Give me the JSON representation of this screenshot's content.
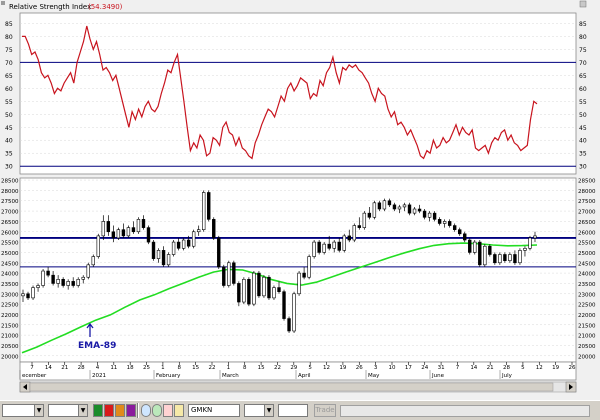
{
  "chart_data": [
    {
      "type": "line",
      "title": "Relative Strength Index",
      "value_label": "(54.3490)",
      "ylim": [
        27,
        89
      ],
      "y_ticks": [
        "30",
        "35",
        "40",
        "45",
        "50",
        "55",
        "60",
        "65",
        "70",
        "75",
        "80",
        "85"
      ],
      "reference_lines": [
        30,
        70
      ],
      "series": [
        {
          "name": "RSI",
          "x": [
            0,
            1,
            2,
            3,
            4,
            5,
            6,
            7,
            8,
            9,
            10,
            11,
            12,
            13,
            14,
            15,
            16,
            17,
            18,
            19,
            20,
            21,
            22,
            23,
            24,
            25,
            26,
            27,
            28,
            29,
            30,
            31,
            32,
            33,
            34,
            35,
            36,
            37,
            38,
            39,
            40,
            41,
            42,
            43,
            44,
            45,
            46,
            47,
            48,
            49,
            50,
            51,
            52,
            53,
            54,
            55,
            56,
            57,
            58,
            59,
            60,
            61,
            62,
            63,
            64,
            65,
            66,
            67,
            68,
            69,
            70,
            71,
            72,
            73,
            74,
            75,
            76,
            77,
            78,
            79,
            80,
            81,
            82,
            83,
            84,
            85,
            86,
            87,
            88,
            89,
            90,
            91,
            92,
            93,
            94,
            95,
            96,
            97,
            98,
            99,
            100,
            101,
            102,
            103,
            104,
            105,
            106,
            107,
            108,
            109,
            110,
            111,
            112,
            113,
            114,
            115,
            116,
            117,
            118,
            119,
            120,
            121,
            122,
            123,
            124,
            125,
            126,
            127,
            128,
            129,
            130,
            131,
            132,
            133,
            134,
            135,
            136,
            137,
            138,
            139,
            140,
            141,
            142,
            143,
            144,
            145,
            146,
            147,
            148,
            149,
            150,
            151,
            152,
            153,
            154,
            155,
            156,
            157,
            158,
            159
          ],
          "values": [
            80,
            80,
            77,
            73,
            74,
            71,
            66,
            64,
            65,
            62,
            58,
            60,
            59,
            62,
            64,
            66,
            62,
            70,
            74,
            78,
            84,
            79,
            75,
            78,
            73,
            67,
            68,
            66,
            63,
            65,
            60,
            55,
            50,
            45,
            51,
            48,
            52,
            49,
            53,
            55,
            52,
            51,
            53,
            58,
            62,
            67,
            66,
            70,
            73,
            64,
            55,
            45,
            36,
            39,
            37,
            42,
            40,
            34,
            35,
            41,
            40,
            38,
            45,
            47,
            43,
            42,
            38,
            41,
            37,
            36,
            34,
            33,
            39,
            42,
            46,
            49,
            52,
            51,
            49,
            53,
            57,
            55,
            60,
            62,
            59,
            61,
            64,
            63,
            62,
            56,
            58,
            57,
            63,
            61,
            66,
            68,
            72,
            66,
            62,
            68,
            67,
            69,
            68,
            69,
            67,
            66,
            64,
            62,
            58,
            55,
            60,
            58,
            57,
            52,
            49,
            51,
            46,
            47,
            45,
            42,
            44,
            41,
            38,
            34,
            33,
            36,
            35,
            40,
            37,
            38,
            41,
            39,
            40,
            43,
            46,
            42,
            45,
            43,
            42,
            44,
            37,
            36,
            37,
            38,
            35,
            39,
            41,
            40,
            43,
            44,
            40,
            42,
            39,
            38,
            36,
            37,
            38,
            48,
            55,
            54
          ]
        }
      ]
    },
    {
      "type": "candlestick",
      "ylim": [
        19700,
        28600
      ],
      "y_ticks": [
        "20000",
        "20500",
        "21000",
        "21500",
        "22000",
        "22500",
        "23000",
        "23500",
        "24000",
        "24500",
        "25000",
        "25500",
        "26000",
        "26500",
        "27000",
        "27500",
        "28000",
        "28500"
      ],
      "reference_lines": [
        25700,
        24300
      ],
      "x_ticks": [
        "7",
        "14",
        "21",
        "28",
        "4",
        "11",
        "18",
        "25",
        "1",
        "8",
        "15",
        "22",
        "1",
        "8",
        "15",
        "22",
        "29",
        "5",
        "12",
        "19",
        "26",
        "3",
        "10",
        "17",
        "24",
        "31",
        "7",
        "14",
        "21",
        "28",
        "5",
        "12",
        "19",
        "26"
      ],
      "month_labels": [
        "ecember",
        "2021",
        "February",
        "March",
        "April",
        "May",
        "June",
        "July"
      ],
      "annotation": "EMA-89",
      "ema_89": [
        [
          0,
          20150
        ],
        [
          5,
          20420
        ],
        [
          10,
          20750
        ],
        [
          15,
          21060
        ],
        [
          20,
          21400
        ],
        [
          25,
          21720
        ],
        [
          30,
          21980
        ],
        [
          35,
          22350
        ],
        [
          40,
          22700
        ],
        [
          45,
          22950
        ],
        [
          50,
          23250
        ],
        [
          55,
          23520
        ],
        [
          60,
          23800
        ],
        [
          65,
          24050
        ],
        [
          70,
          24180
        ],
        [
          75,
          24150
        ],
        [
          80,
          23950
        ],
        [
          85,
          23680
        ],
        [
          90,
          23500
        ],
        [
          95,
          23420
        ],
        [
          100,
          23560
        ],
        [
          105,
          23800
        ],
        [
          110,
          24050
        ],
        [
          115,
          24280
        ],
        [
          120,
          24520
        ],
        [
          125,
          24760
        ],
        [
          130,
          24980
        ],
        [
          135,
          25180
        ],
        [
          140,
          25340
        ],
        [
          145,
          25420
        ],
        [
          150,
          25450
        ],
        [
          155,
          25420
        ],
        [
          160,
          25360
        ],
        [
          165,
          25320
        ],
        [
          170,
          25330
        ],
        [
          175,
          25360
        ]
      ],
      "candles": [
        [
          22900,
          23200,
          22600,
          23000
        ],
        [
          23000,
          23100,
          22700,
          22800
        ],
        [
          22800,
          23400,
          22700,
          23300
        ],
        [
          23300,
          23500,
          23100,
          23400
        ],
        [
          23400,
          24200,
          23300,
          24100
        ],
        [
          24100,
          24300,
          23800,
          23900
        ],
        [
          23900,
          24100,
          23400,
          23500
        ],
        [
          23500,
          23900,
          23300,
          23700
        ],
        [
          23700,
          23800,
          23300,
          23400
        ],
        [
          23400,
          23700,
          23200,
          23600
        ],
        [
          23600,
          23800,
          23300,
          23400
        ],
        [
          23400,
          23800,
          23300,
          23700
        ],
        [
          23700,
          23900,
          23500,
          23800
        ],
        [
          23800,
          24500,
          23700,
          24400
        ],
        [
          24400,
          24900,
          24300,
          24800
        ],
        [
          24800,
          25900,
          24700,
          25800
        ],
        [
          25800,
          26800,
          25600,
          26500
        ],
        [
          26500,
          26800,
          25800,
          26000
        ],
        [
          26000,
          26300,
          25500,
          25700
        ],
        [
          25700,
          26200,
          25600,
          26100
        ],
        [
          26100,
          26400,
          25700,
          25800
        ],
        [
          25800,
          26300,
          25700,
          26200
        ],
        [
          26200,
          26500,
          25900,
          26000
        ],
        [
          26000,
          26700,
          25900,
          26600
        ],
        [
          26600,
          26800,
          26100,
          26200
        ],
        [
          26200,
          26300,
          25400,
          25500
        ],
        [
          25500,
          25600,
          24600,
          24700
        ],
        [
          24700,
          25200,
          24500,
          25100
        ],
        [
          25100,
          25300,
          24300,
          24400
        ],
        [
          24400,
          25000,
          24300,
          24900
        ],
        [
          24900,
          25600,
          24800,
          25500
        ],
        [
          25500,
          25700,
          25100,
          25200
        ],
        [
          25200,
          25700,
          25100,
          25600
        ],
        [
          25600,
          25800,
          25200,
          25300
        ],
        [
          25300,
          26100,
          25200,
          26000
        ],
        [
          26000,
          26300,
          25800,
          26100
        ],
        [
          26100,
          28000,
          26000,
          27900
        ],
        [
          27900,
          28000,
          26500,
          26600
        ],
        [
          26600,
          26700,
          25600,
          25700
        ],
        [
          25700,
          25800,
          24200,
          24300
        ],
        [
          24300,
          24400,
          23300,
          23400
        ],
        [
          23400,
          24600,
          23300,
          24500
        ],
        [
          24500,
          24600,
          23400,
          23500
        ],
        [
          23500,
          23600,
          22400,
          22600
        ],
        [
          22600,
          23800,
          22500,
          23700
        ],
        [
          23700,
          23800,
          22400,
          22500
        ],
        [
          22500,
          24100,
          22400,
          24000
        ],
        [
          24000,
          24100,
          22800,
          22900
        ],
        [
          22900,
          23900,
          22800,
          23800
        ],
        [
          23800,
          23900,
          22700,
          22800
        ],
        [
          22800,
          23400,
          22700,
          23300
        ],
        [
          23300,
          23600,
          23000,
          23100
        ],
        [
          23100,
          23200,
          21700,
          21800
        ],
        [
          21800,
          21900,
          21100,
          21200
        ],
        [
          21200,
          23100,
          21100,
          23000
        ],
        [
          23000,
          24100,
          22900,
          24000
        ],
        [
          24000,
          24300,
          23700,
          23800
        ],
        [
          23800,
          24900,
          23700,
          24800
        ],
        [
          24800,
          25600,
          24700,
          25500
        ],
        [
          25500,
          25600,
          24900,
          25000
        ],
        [
          25000,
          25500,
          24900,
          25400
        ],
        [
          25400,
          25800,
          25100,
          25200
        ],
        [
          25200,
          25600,
          25000,
          25500
        ],
        [
          25500,
          25700,
          25000,
          25100
        ],
        [
          25100,
          25900,
          25000,
          25800
        ],
        [
          25800,
          26100,
          25500,
          25600
        ],
        [
          25600,
          26400,
          25500,
          26300
        ],
        [
          26300,
          26700,
          26100,
          26200
        ],
        [
          26200,
          27000,
          26100,
          26900
        ],
        [
          26900,
          27200,
          26600,
          26700
        ],
        [
          26700,
          27500,
          26600,
          27400
        ],
        [
          27400,
          27500,
          27000,
          27100
        ],
        [
          27100,
          27600,
          27000,
          27500
        ],
        [
          27500,
          27600,
          27200,
          27300
        ],
        [
          27300,
          27400,
          27000,
          27100
        ],
        [
          27100,
          27300,
          26900,
          27200
        ],
        [
          27200,
          27400,
          27000,
          27300
        ],
        [
          27300,
          27400,
          26800,
          26900
        ],
        [
          26900,
          27200,
          26800,
          27100
        ],
        [
          27100,
          27300,
          26900,
          27000
        ],
        [
          27000,
          27100,
          26600,
          26700
        ],
        [
          26700,
          27000,
          26500,
          26900
        ],
        [
          26900,
          27000,
          26500,
          26600
        ],
        [
          26600,
          26700,
          26300,
          26400
        ],
        [
          26400,
          26600,
          26200,
          26500
        ],
        [
          26500,
          26600,
          26200,
          26300
        ],
        [
          26300,
          26400,
          26000,
          26100
        ],
        [
          26100,
          26200,
          25800,
          25900
        ],
        [
          25900,
          26000,
          25500,
          25600
        ],
        [
          25600,
          25700,
          24900,
          25000
        ],
        [
          25000,
          25600,
          24900,
          25500
        ],
        [
          25500,
          25600,
          24300,
          24400
        ],
        [
          24400,
          25400,
          24300,
          25300
        ],
        [
          25300,
          25400,
          24800,
          24900
        ],
        [
          24900,
          25000,
          24400,
          24500
        ],
        [
          24500,
          25000,
          24400,
          24900
        ],
        [
          24900,
          25000,
          24500,
          24600
        ],
        [
          24600,
          25000,
          24500,
          24900
        ],
        [
          24900,
          25100,
          24400,
          24500
        ],
        [
          24500,
          25200,
          24400,
          25100
        ],
        [
          25100,
          25300,
          24800,
          25200
        ],
        [
          25200,
          25800,
          25100,
          25700
        ],
        [
          25700,
          26000,
          25500,
          25800
        ]
      ]
    }
  ],
  "toolbar": {
    "combo1_value": "",
    "combo2_value": "",
    "symbol_value": "GMKN",
    "period_value": "",
    "trade_label": "Trade"
  },
  "colors": {
    "rsi_line": "#c8141e",
    "ema_line": "#22dd22",
    "reference_line": "#00007f",
    "annotation": "#1a1aa6",
    "candle": "#000000"
  }
}
